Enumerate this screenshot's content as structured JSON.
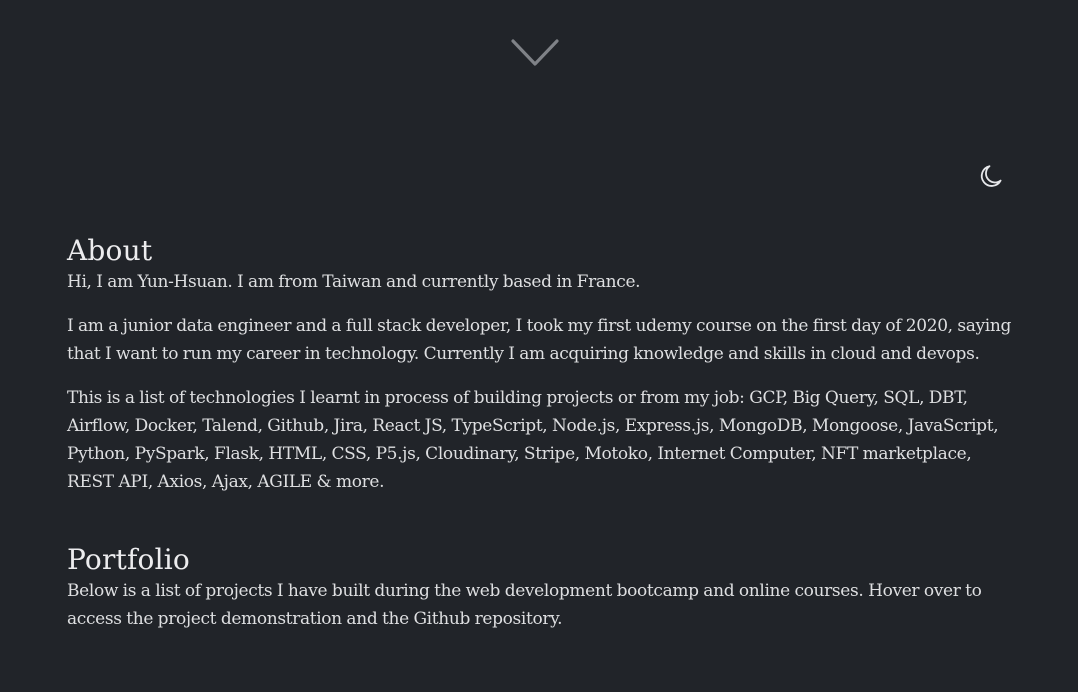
{
  "header": {
    "scroll_icon": "chevron-down-icon",
    "theme_icon": "moon-icon"
  },
  "about": {
    "title": "About",
    "intro": "Hi, I am Yun-Hsuan. I am from Taiwan and currently based in France.",
    "career": "I am a junior data engineer and a full stack developer, I took my first udemy course on the first day of 2020, saying that I want to run my career in technology. Currently I am acquiring knowledge and skills in cloud and devops.",
    "technologies": "This is a list of technologies I learnt in process of building projects or from my job: GCP, Big Query, SQL, DBT, Airflow, Docker, Talend, Github, Jira, React JS, TypeScript, Node.js, Express.js, MongoDB, Mongoose, JavaScript, Python, PySpark, Flask, HTML, CSS, P5.js, Cloudinary, Stripe, Motoko, Internet Computer, NFT marketplace, REST API, Axios, Ajax, AGILE & more."
  },
  "portfolio": {
    "title": "Portfolio",
    "description": "Below is a list of projects I have built during the web development bootcamp and online courses. Hover over to access the project demonstration and the Github repository."
  },
  "colors": {
    "background": "#212429",
    "text": "#dedfe1",
    "icon": "#8a8d92"
  }
}
